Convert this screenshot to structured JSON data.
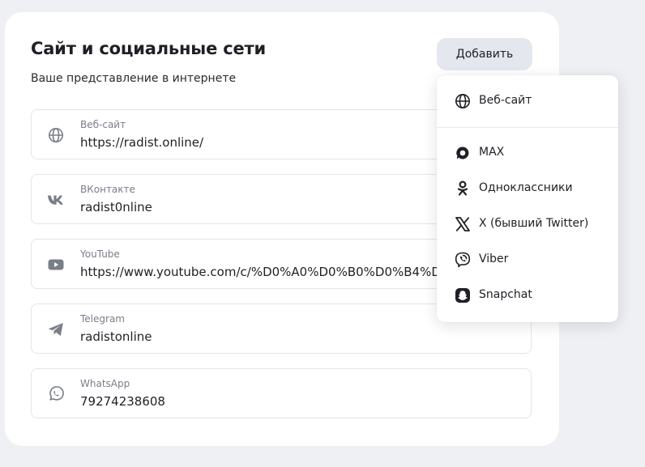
{
  "section": {
    "title": "Сайт и социальные сети",
    "subtitle": "Ваше представление в интернете",
    "add_label": "Добавить"
  },
  "fields": [
    {
      "label": "Веб-сайт",
      "value": "https://radist.online/",
      "icon": "globe-icon"
    },
    {
      "label": "ВКонтакте",
      "value": "radist0nline",
      "icon": "vk-icon"
    },
    {
      "label": "YouTube",
      "value": "https://www.youtube.com/c/%D0%A0%D0%B0%D0%B4%D0%B8",
      "icon": "youtube-icon"
    },
    {
      "label": "Telegram",
      "value": "radistonline",
      "icon": "telegram-icon"
    },
    {
      "label": "WhatsApp",
      "value": "79274238608",
      "icon": "whatsapp-icon"
    }
  ],
  "menu": {
    "items": [
      {
        "label": "Веб-сайт",
        "icon": "globe-icon"
      },
      {
        "label": "MAX",
        "icon": "max-icon"
      },
      {
        "label": "Одноклассники",
        "icon": "odnoklassniki-icon"
      },
      {
        "label": "X (бывший Twitter)",
        "icon": "x-twitter-icon"
      },
      {
        "label": "Viber",
        "icon": "viber-icon"
      },
      {
        "label": "Snapchat",
        "icon": "snapchat-icon"
      }
    ]
  },
  "colors": {
    "background": "#eef0f3",
    "card": "#ffffff",
    "button": "#e4e7ee",
    "icon_gray": "#7a7e88",
    "text": "#1f2026"
  }
}
